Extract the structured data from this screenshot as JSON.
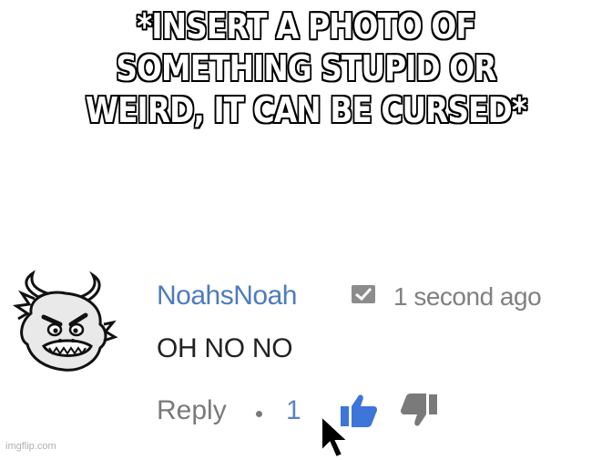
{
  "caption": {
    "lines": [
      "*INSERT A PHOTO OF",
      "SOMETHING STUPID OR",
      "WEIRD, IT CAN BE CURSED*"
    ]
  },
  "comment": {
    "username": "NoahsNoah",
    "timestamp": "1 second ago",
    "text": "OH NO NO",
    "reply_label": "Reply",
    "like_count": "1",
    "avatar_icon": "bowser-face-icon",
    "verified_icon": "checkmark-badge-icon",
    "like_icon": "thumbs-up-icon",
    "dislike_icon": "thumbs-down-icon",
    "username_color": "#4d7bbf",
    "like_color": "#3d75d9"
  },
  "cursor_icon": "mouse-pointer-icon",
  "watermark": "imgflip.com"
}
